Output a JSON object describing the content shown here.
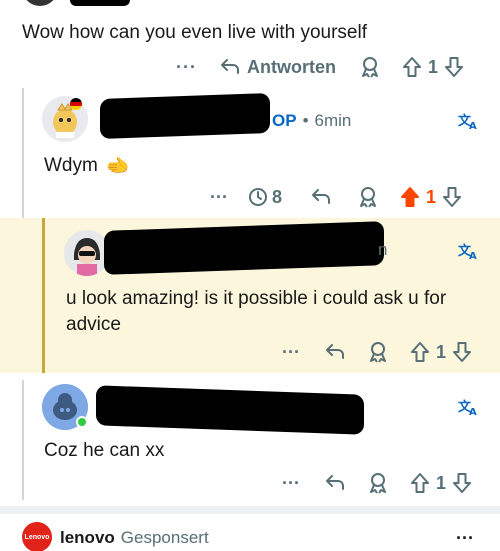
{
  "comment1": {
    "text": "Wow how can you even live with yourself",
    "actions": {
      "more": "···",
      "reply_label": "Antworten",
      "votes": "1"
    }
  },
  "comment2": {
    "op_label": "OP",
    "separator": "•",
    "time": "6min",
    "text": "Wdym",
    "emoji": "🫲",
    "actions": {
      "more": "···",
      "awards": "8",
      "votes": "1"
    }
  },
  "comment3": {
    "time_fragment": "n",
    "text": "u look amazing! is it possible i could ask u for advice",
    "actions": {
      "more": "···",
      "votes": "1"
    }
  },
  "comment4": {
    "text": "Coz he can xx",
    "actions": {
      "more": "···",
      "votes": "1"
    }
  },
  "ad": {
    "brand_logo_text": "Lenovo",
    "brand": "lenovo",
    "sponsored": "Gesponsert",
    "more": "···"
  },
  "colors": {
    "upvote_active": "#ff4500",
    "highlight_bg": "#fbf6dc",
    "highlight_bar": "#c9a53a",
    "muted": "#576f76"
  }
}
